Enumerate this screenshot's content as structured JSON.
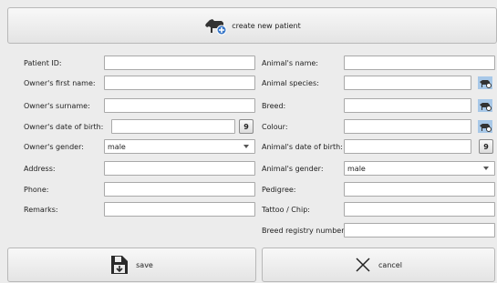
{
  "header": {
    "title": "create new patient",
    "icon": "horse-add-icon"
  },
  "owner": {
    "patient_id": {
      "label": "Patient ID:",
      "value": ""
    },
    "first_name": {
      "label": "Owner's first name:",
      "value": ""
    },
    "surname": {
      "label": "Owner's surname:",
      "value": ""
    },
    "dob": {
      "label": "Owner's date of birth:",
      "value": ""
    },
    "gender": {
      "label": "Owner's gender:",
      "value": "male"
    },
    "address": {
      "label": "Address:",
      "value": ""
    },
    "phone": {
      "label": "Phone:",
      "value": ""
    },
    "remarks": {
      "label": "Remarks:",
      "value": ""
    }
  },
  "animal": {
    "name": {
      "label": "Animal's name:",
      "value": ""
    },
    "species": {
      "label": "Animal species:",
      "value": ""
    },
    "breed": {
      "label": "Breed:",
      "value": ""
    },
    "colour": {
      "label": "Colour:",
      "value": ""
    },
    "dob": {
      "label": "Animal's date of birth:",
      "value": ""
    },
    "gender": {
      "label": "Animal's gender:",
      "value": "male"
    },
    "pedigree": {
      "label": "Pedigree:",
      "value": ""
    },
    "tattoo": {
      "label": "Tattoo / Chip:",
      "value": ""
    },
    "registry": {
      "label": "Breed registry number:",
      "value": ""
    }
  },
  "footer": {
    "save_label": "save",
    "cancel_label": "cancel"
  },
  "calendar_icon_text": "9"
}
